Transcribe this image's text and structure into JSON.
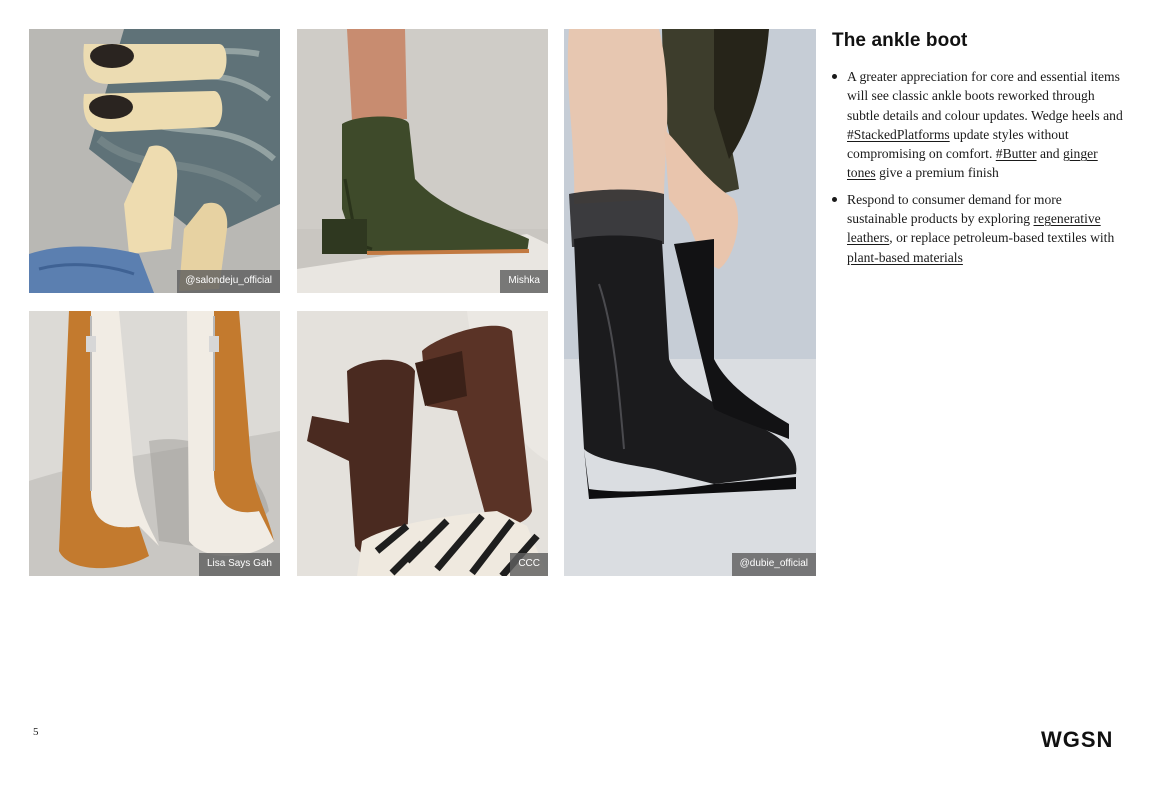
{
  "photos": [
    {
      "credit": "@salondeju_official",
      "icon": "cream-ankle-boots-photo"
    },
    {
      "credit": "Mishka",
      "icon": "green-leather-boot-photo"
    },
    {
      "credit": "Lisa Says Gah",
      "icon": "two-tone-zip-boots-photo"
    },
    {
      "credit": "CCC",
      "icon": "brown-heeled-boots-photo"
    },
    {
      "credit": "@dubie_official",
      "icon": "black-wedge-boots-photo"
    }
  ],
  "section": {
    "title": "The ankle boot",
    "bullets": [
      {
        "t1": "A greater appreciation for core and essential items will see classic ankle boots reworked through subtle details and colour updates. Wedge heels and ",
        "link1": "#StackedPlatforms",
        "t2": " update styles without compromising on comfort. ",
        "link2": "#Butter",
        "t3": " and ",
        "link3": "ginger tones",
        "t4": " give a premium finish"
      },
      {
        "t1": "Respond to consumer demand for more sustainable products by exploring ",
        "link1": "regenerative leathers",
        "t2": ", or replace petroleum-based textiles with ",
        "link2": "plant-based materials"
      }
    ]
  },
  "footer": {
    "page_number": "5",
    "logo": "WGSN"
  },
  "colors": {
    "credit_bg": "#5f5f5f",
    "text": "#1a1a1a"
  }
}
